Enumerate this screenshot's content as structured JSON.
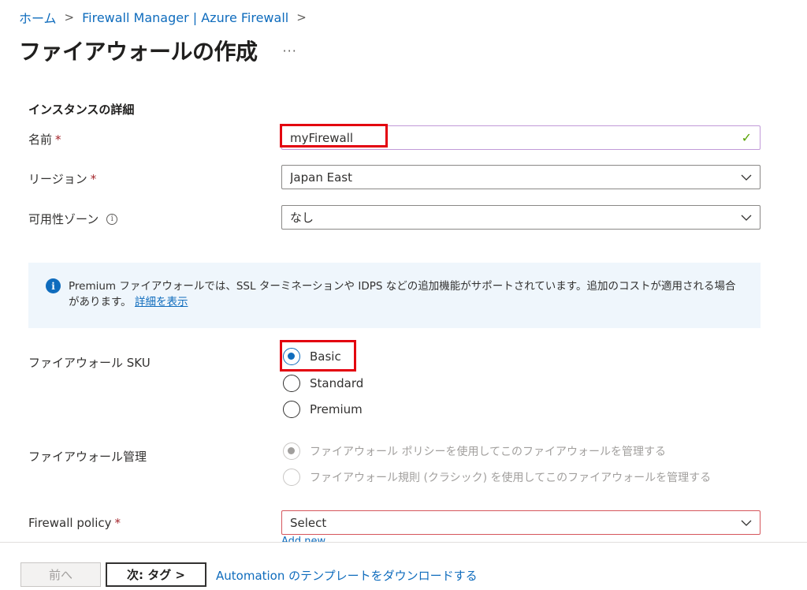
{
  "breadcrumb": {
    "home": "ホーム",
    "parent": "Firewall Manager | Azure Firewall",
    "separator": ">"
  },
  "page": {
    "title": "ファイアウォールの作成",
    "more": "···"
  },
  "instance": {
    "heading": "インスタンスの詳細",
    "name": {
      "label": "名前",
      "required": "*",
      "value": "myFirewall"
    },
    "region": {
      "label": "リージョン",
      "required": "*",
      "value": "Japan East"
    },
    "zone": {
      "label": "可用性ゾーン",
      "info": "i",
      "value": "なし"
    }
  },
  "banner": {
    "icon": "info-icon",
    "text": "Premium ファイアウォールでは、SSL ターミネーションや IDPS などの追加機能がサポートされています。追加のコストが適用される場合があります。",
    "link": "詳細を表示"
  },
  "sku": {
    "label": "ファイアウォール SKU",
    "options": [
      {
        "label": "Basic",
        "checked": true
      },
      {
        "label": "Standard",
        "checked": false
      },
      {
        "label": "Premium",
        "checked": false
      }
    ]
  },
  "management": {
    "label": "ファイアウォール管理",
    "options": [
      {
        "label": "ファイアウォール ポリシーを使用してこのファイアウォールを管理する",
        "checked": true,
        "disabled": true
      },
      {
        "label": "ファイアウォール規則 (クラシック) を使用してこのファイアウォールを管理する",
        "checked": false,
        "disabled": true
      }
    ]
  },
  "policy": {
    "label": "Firewall policy",
    "required": "*",
    "value": "Select",
    "add_link": "Add new"
  },
  "footer": {
    "prev": "前へ",
    "next": "次: タグ >",
    "download": "Automation のテンプレートをダウンロードする"
  },
  "colors": {
    "accent": "#0f6cbd",
    "highlight_box": "#e3000f",
    "required": "#a4262c",
    "valid_check": "#57a300"
  }
}
